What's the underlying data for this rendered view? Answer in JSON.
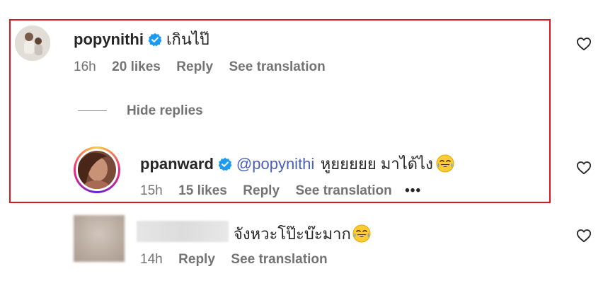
{
  "comment1": {
    "username": "popynithi",
    "text": "เกินไป๊",
    "time": "16h",
    "likes": "20 likes",
    "reply": "Reply",
    "translate": "See translation"
  },
  "hide_replies": "Hide replies",
  "reply1": {
    "username": "ppanward",
    "mention": "@popynithi",
    "text": "หูยยยยย มาได้ไง",
    "time": "15h",
    "likes": "15 likes",
    "reply": "Reply",
    "translate": "See translation",
    "more": "•••"
  },
  "comment2": {
    "text": "จังหวะโป๊ะบ๊ะมาก",
    "time": "14h",
    "reply": "Reply",
    "translate": "See translation"
  },
  "colors": {
    "highlight_border": "#e0141e",
    "verified": "#1d9bf0",
    "mention": "#4a5fb8",
    "muted": "#737373"
  },
  "icons": [
    "heart-icon",
    "verified-badge-icon",
    "tears-of-joy-emoji",
    "more-options-icon"
  ]
}
